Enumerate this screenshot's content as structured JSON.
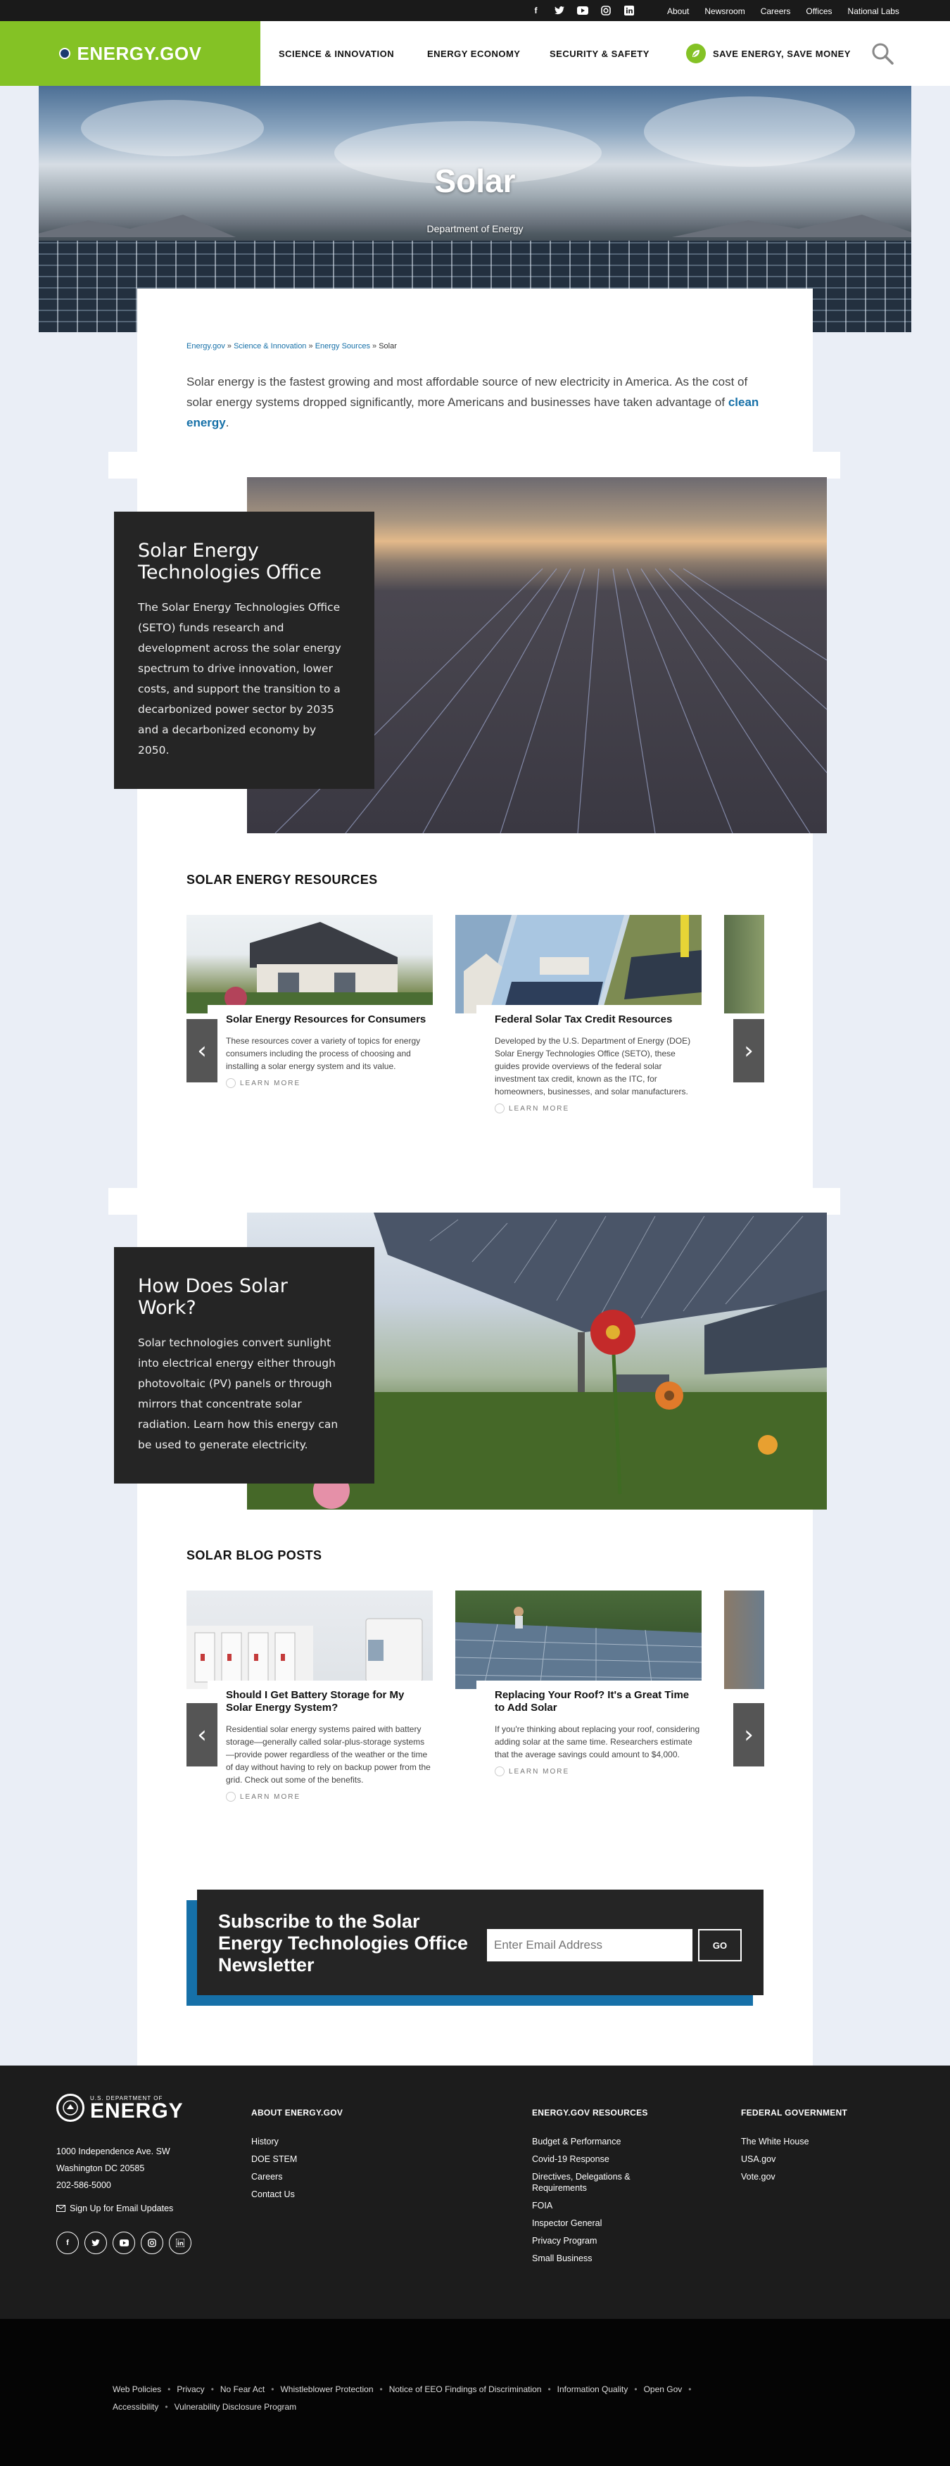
{
  "utility_bar": {
    "social_icons": [
      "facebook-icon",
      "twitter-icon",
      "youtube-icon",
      "instagram-icon",
      "linkedin-icon"
    ],
    "links": [
      "About",
      "Newsroom",
      "Careers",
      "Offices",
      "National Labs"
    ]
  },
  "header": {
    "logo_text": "ENERGY.GOV",
    "nav": [
      "SCIENCE & INNOVATION",
      "ENERGY ECONOMY",
      "SECURITY & SAFETY",
      "SAVE ENERGY, SAVE MONEY"
    ]
  },
  "hero": {
    "title": "Solar",
    "subtitle": "Department of Energy"
  },
  "breadcrumb": [
    "Energy.gov",
    "Science & Innovation",
    "Energy Sources",
    "Solar"
  ],
  "breadcrumb_sep": "»",
  "intro": {
    "text": "Solar energy is the fastest growing and most affordable source of new electricity in America. As the cost of solar energy systems dropped significantly, more Americans and businesses have taken advantage of ",
    "link": "clean energy",
    "end": "."
  },
  "feature1": {
    "title": "Solar Energy Technologies Office",
    "body": "The Solar Energy Technologies Office (SETO) funds research and development across the solar energy spectrum to drive innovation, lower costs, and support the transition to a decarbonized power sector by 2035 and a decarbonized economy by 2050."
  },
  "resources": {
    "title": "SOLAR ENERGY RESOURCES",
    "cards": [
      {
        "title": "Solar Energy Resources for Consumers",
        "body": "These resources cover a variety of topics for energy consumers including the process of choosing and installing a solar energy system and its value.",
        "cta": "LEARN MORE"
      },
      {
        "title": "Federal Solar Tax Credit Resources",
        "body": "Developed by the U.S. Department of Energy (DOE) Solar Energy Technologies Office (SETO), these guides provide overviews of the federal solar investment tax credit, known as the ITC, for homeowners, businesses, and solar manufacturers.",
        "cta": "LEARN MORE"
      }
    ]
  },
  "feature2": {
    "title": "How Does Solar Work?",
    "body": "Solar technologies convert sunlight into electrical energy either through photovoltaic (PV) panels or through mirrors that concentrate solar radiation. Learn how this energy can be used to generate electricity."
  },
  "blog": {
    "title": "SOLAR BLOG POSTS",
    "cards": [
      {
        "title": "Should I Get Battery Storage for My Solar Energy System?",
        "body": "Residential solar energy systems paired with battery storage—generally called solar-plus-storage systems—provide power regardless of the weather or the time of day without having to rely on backup power from the grid. Check out some of the benefits.",
        "cta": "LEARN MORE"
      },
      {
        "title": "Replacing Your Roof? It's a Great Time to Add Solar",
        "body": "If you're thinking about replacing your roof, considering adding solar at the same time. Researchers estimate that the average savings could amount to $4,000.",
        "cta": "LEARN MORE"
      }
    ]
  },
  "subscribe": {
    "title": "Subscribe to the Solar Energy Technologies Office Newsletter",
    "placeholder": "Enter Email Address",
    "button": "GO"
  },
  "footer": {
    "logo_small": "U.S. DEPARTMENT OF",
    "logo_big": "ENERGY",
    "address": [
      "1000 Independence Ave. SW",
      "Washington DC 20585",
      "202-586-5000"
    ],
    "signup": "Sign Up for Email Updates",
    "social_icons": [
      "facebook-icon",
      "twitter-icon",
      "youtube-icon",
      "instagram-icon",
      "linkedin-icon"
    ],
    "col1": {
      "title": "ABOUT ENERGY.GOV",
      "links": [
        "History",
        "DOE STEM",
        "Careers",
        "Contact Us"
      ]
    },
    "col2": {
      "title": "ENERGY.GOV RESOURCES",
      "links": [
        "Budget & Performance",
        "Covid-19 Response",
        "Directives, Delegations & Requirements",
        "FOIA",
        "Inspector General",
        "Privacy Program",
        "Small Business"
      ]
    },
    "col3": {
      "title": "FEDERAL GOVERNMENT",
      "links": [
        "The White House",
        "USA.gov",
        "Vote.gov"
      ]
    }
  },
  "bottom_links": [
    "Web Policies",
    "Privacy",
    "No Fear Act",
    "Whistleblower Protection",
    "Notice of EEO Findings of Discrimination",
    "Information Quality",
    "Open Gov",
    "Accessibility",
    "Vulnerability Disclosure Program"
  ]
}
